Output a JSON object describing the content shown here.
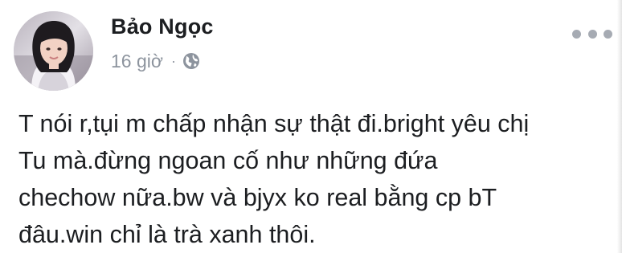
{
  "post": {
    "author": "Bảo Ngọc",
    "time": "16 giờ",
    "separator": "·",
    "audience_icon": "globe-icon",
    "more_icon": "more-options-icon",
    "text": "T nói r,tụi m chấp nhận sự thật đi.bright yêu chị\nTu mà.đừng ngoan cố như những đứa\nchechow nữa.bw và bjyx ko real bằng cp bT\nđâu.win chỉ là trà xanh thôi."
  },
  "colors": {
    "name": "#1c1e21",
    "meta": "#8d949e",
    "text": "#1c1e21",
    "background": "#ffffff"
  }
}
